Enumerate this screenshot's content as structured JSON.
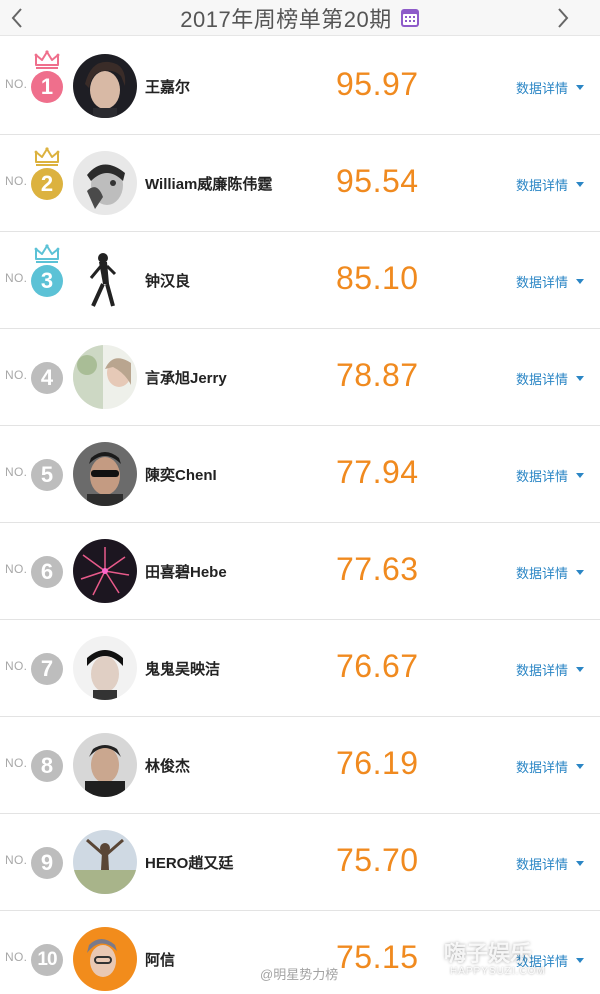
{
  "header": {
    "title": "2017年周榜单第20期",
    "prev_icon": "chevron-left-icon",
    "next_icon": "chevron-right-icon",
    "calendar_icon": "calendar-icon"
  },
  "no_prefix": "NO.",
  "detail_label": "数据详情",
  "colors": {
    "rank1": "#ef6f8c",
    "rank2": "#dcb23f",
    "rank3": "#5cc2d6",
    "rank_other": "#bdbdbd",
    "score": "#f08a1f",
    "link": "#2b86c5"
  },
  "rankings": [
    {
      "rank": "1",
      "name": "王嘉尔",
      "score": "95.97",
      "crown": "pink-crown-icon"
    },
    {
      "rank": "2",
      "name": "William威廉陈伟霆",
      "score": "95.54",
      "crown": "gold-crown-icon"
    },
    {
      "rank": "3",
      "name": "钟汉良",
      "score": "85.10",
      "crown": "teal-crown-icon"
    },
    {
      "rank": "4",
      "name": "言承旭Jerry",
      "score": "78.87"
    },
    {
      "rank": "5",
      "name": "陳奕ChenI",
      "score": "77.94"
    },
    {
      "rank": "6",
      "name": "田喜碧Hebe",
      "score": "77.63"
    },
    {
      "rank": "7",
      "name": "鬼鬼吴映洁",
      "score": "76.67"
    },
    {
      "rank": "8",
      "name": "林俊杰",
      "score": "76.19"
    },
    {
      "rank": "9",
      "name": "HERO趙又廷",
      "score": "75.70"
    },
    {
      "rank": "10",
      "name": "阿信",
      "score": "75.15"
    }
  ],
  "watermark": {
    "weibo": "@明星势力榜",
    "logo": "嗨子娱乐",
    "url": "HAPPYSUZI.COM"
  }
}
